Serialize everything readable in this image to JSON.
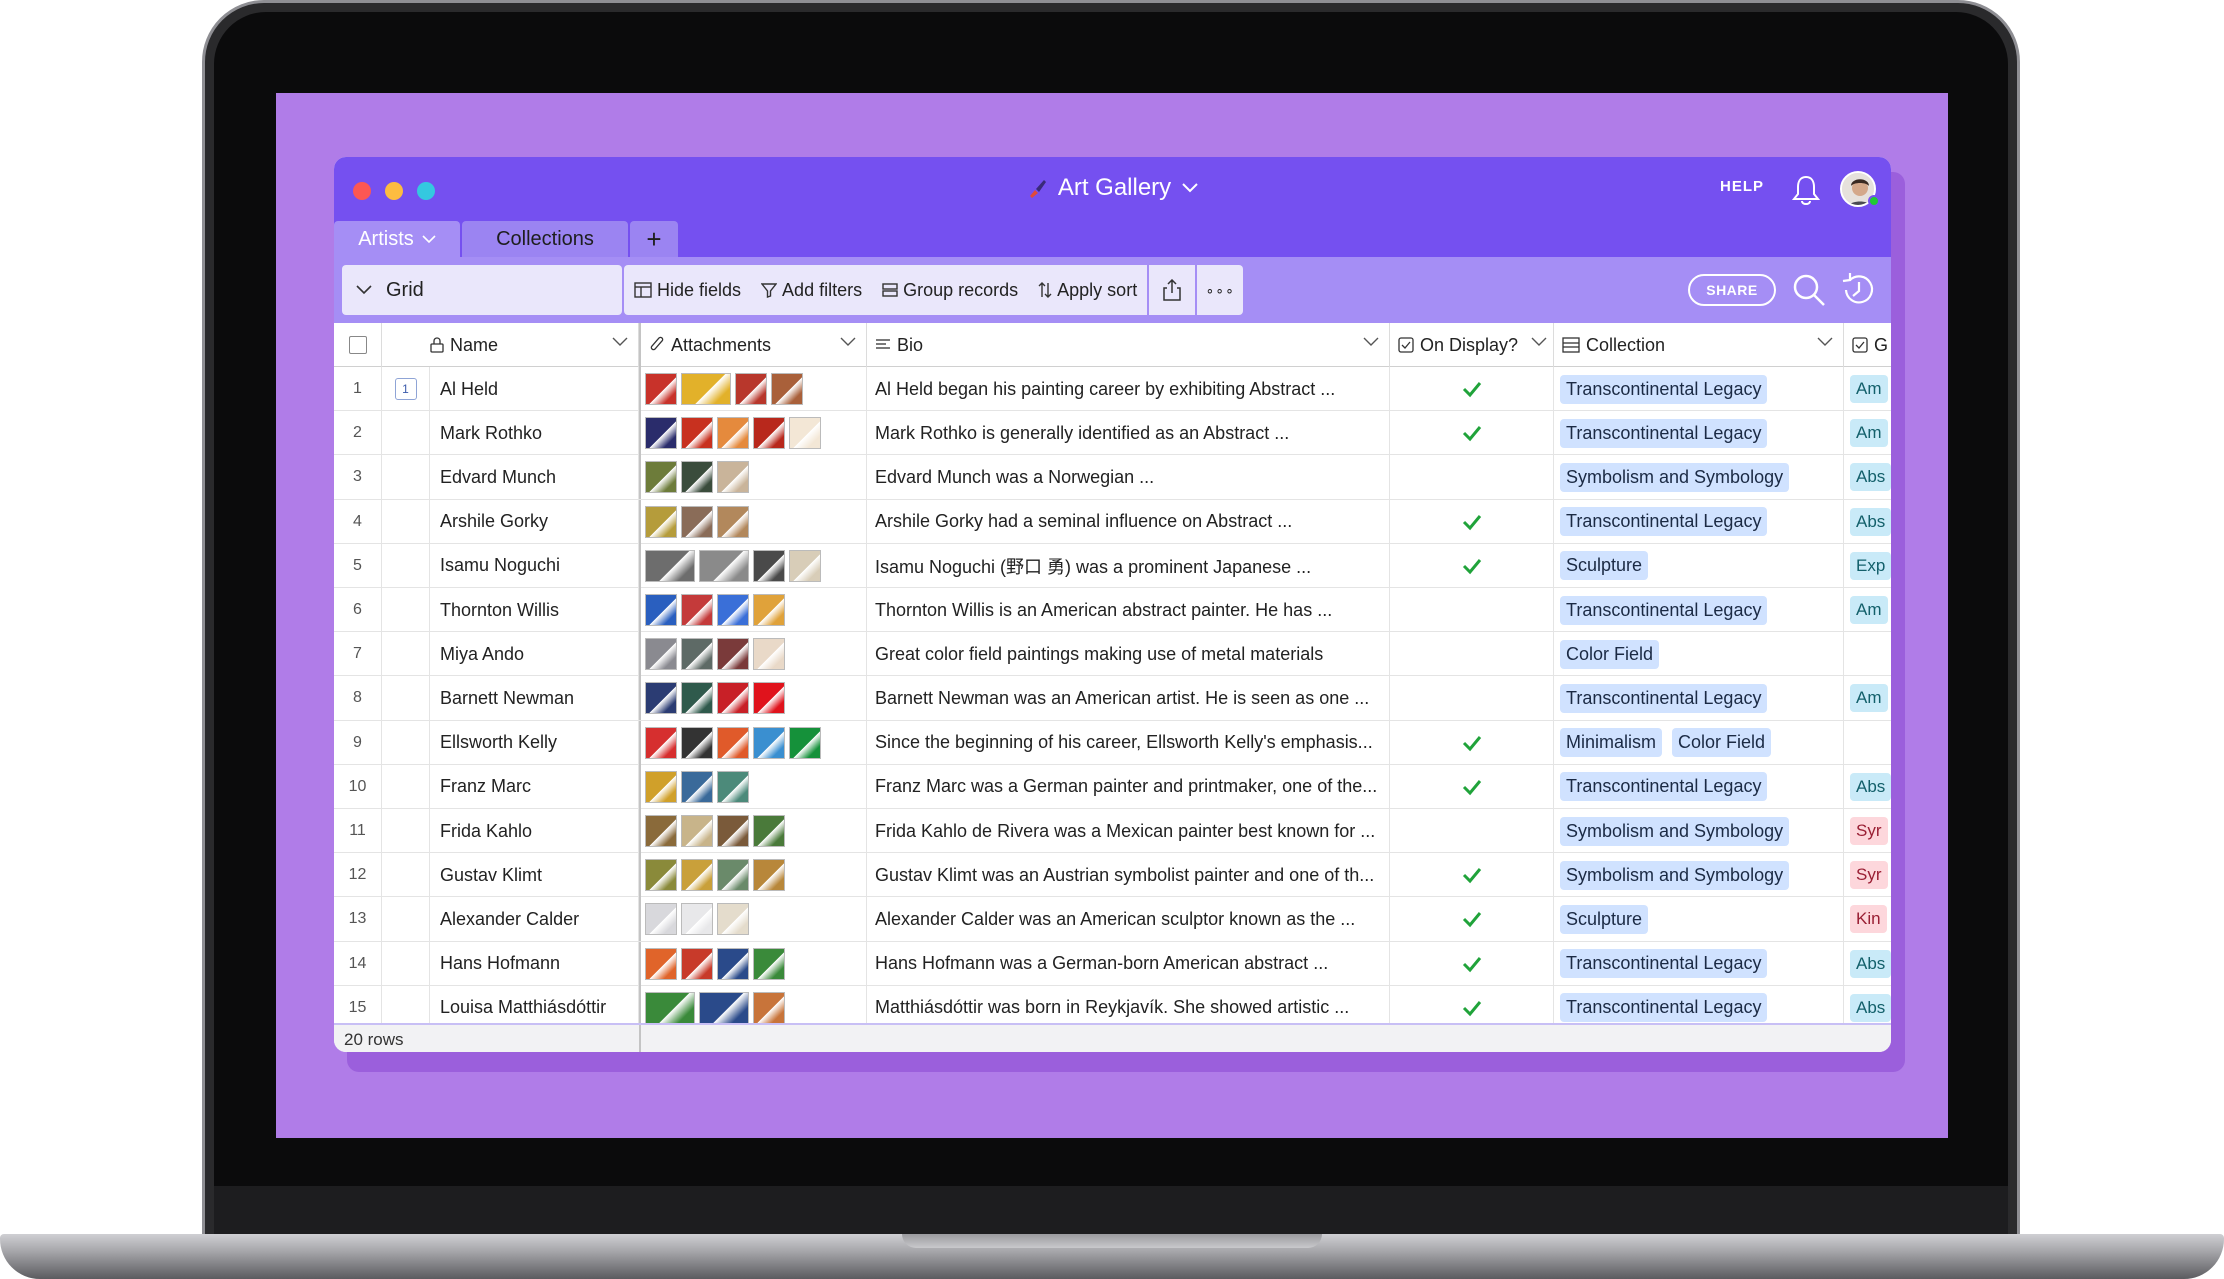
{
  "app": {
    "base_title": "Art Gallery",
    "help_label": "HELP",
    "share_label": "SHARE"
  },
  "tabs": [
    {
      "label": "Artists",
      "active": true
    },
    {
      "label": "Collections",
      "active": false
    },
    {
      "label": "+",
      "active": false
    }
  ],
  "toolbar": {
    "view_name": "Grid",
    "hide_fields": "Hide fields",
    "add_filters": "Add filters",
    "group_records": "Group records",
    "apply_sort": "Apply sort",
    "more": "∘∘∘"
  },
  "columns": {
    "name": "Name",
    "attachments": "Attachments",
    "bio": "Bio",
    "on_display": "On Display?",
    "collection": "Collection",
    "g": "G"
  },
  "rows": [
    {
      "num": "1",
      "name": "Al Held",
      "thumbs": [
        "#c8322a",
        "#e2b12a",
        "#b8372c",
        "#a9603a"
      ],
      "bio": "Al Held began his painting career by exhibiting Abstract ...",
      "on_display": true,
      "collections": [
        "Transcontinental Legacy"
      ],
      "g": "Am"
    },
    {
      "num": "2",
      "name": "Mark Rothko",
      "thumbs": [
        "#2a2c6b",
        "#c8311f",
        "#e58a3d",
        "#b8281c",
        "#f3e7d6"
      ],
      "bio": "Mark Rothko is generally identified as an Abstract ...",
      "on_display": true,
      "collections": [
        "Transcontinental Legacy"
      ],
      "g": "Am"
    },
    {
      "num": "3",
      "name": "Edvard Munch",
      "thumbs": [
        "#6d7c3a",
        "#3a4c3c",
        "#c9b49a"
      ],
      "bio": "Edvard Munch was a Norwegian ...",
      "on_display": false,
      "collections": [
        "Symbolism and Symbology"
      ],
      "g": "Abs"
    },
    {
      "num": "4",
      "name": "Arshile Gorky",
      "thumbs": [
        "#b59c3b",
        "#8a6c58",
        "#b2885c"
      ],
      "bio": "Arshile Gorky had a seminal influence on Abstract ...",
      "on_display": true,
      "collections": [
        "Transcontinental Legacy"
      ],
      "g": "Abs"
    },
    {
      "num": "5",
      "name": "Isamu Noguchi",
      "thumbs": [
        "#6d6d6d",
        "#8a8a8a",
        "#4a4a4a",
        "#d8cdb8"
      ],
      "bio": "Isamu Noguchi (野口 勇) was a prominent Japanese ...",
      "on_display": true,
      "collections": [
        "Sculpture"
      ],
      "g": "Exp"
    },
    {
      "num": "6",
      "name": "Thornton Willis",
      "thumbs": [
        "#2a5fbf",
        "#c43a3a",
        "#3a6fd8",
        "#e0a23a"
      ],
      "bio": "Thornton Willis is an American abstract painter. He has ...",
      "on_display": false,
      "collections": [
        "Transcontinental Legacy"
      ],
      "g": "Am"
    },
    {
      "num": "7",
      "name": "Miya Ando",
      "thumbs": [
        "#8a8a90",
        "#5e6a66",
        "#7a3a3a",
        "#e9d9c8"
      ],
      "bio": "Great color field paintings making use of metal materials",
      "on_display": false,
      "collections": [
        "Color Field"
      ],
      "g": ""
    },
    {
      "num": "8",
      "name": "Barnett Newman",
      "thumbs": [
        "#2b3c73",
        "#2f5a4c",
        "#c82027",
        "#e0131c"
      ],
      "bio": "Barnett Newman was an American artist. He is seen as one ...",
      "on_display": false,
      "collections": [
        "Transcontinental Legacy"
      ],
      "g": "Am"
    },
    {
      "num": "9",
      "name": "Ellsworth Kelly",
      "thumbs": [
        "#d62f2f",
        "#333333",
        "#e05a2a",
        "#3a8fd0",
        "#15913a"
      ],
      "bio": "Since the beginning of his career, Ellsworth Kelly's emphasis...",
      "on_display": true,
      "collections": [
        "Minimalism",
        "Color Field"
      ],
      "g": ""
    },
    {
      "num": "10",
      "name": "Franz Marc",
      "thumbs": [
        "#d0a02a",
        "#3a6a9a",
        "#4c8a7a"
      ],
      "bio": "Franz Marc was a German painter and printmaker, one of the...",
      "on_display": true,
      "collections": [
        "Transcontinental Legacy"
      ],
      "g": "Abs"
    },
    {
      "num": "11",
      "name": "Frida Kahlo",
      "thumbs": [
        "#8a6a3a",
        "#c8b48a",
        "#7a5a3a",
        "#4a7a3a"
      ],
      "bio": "Frida Kahlo de Rivera was a Mexican painter best known for ...",
      "on_display": false,
      "collections": [
        "Symbolism and Symbology"
      ],
      "g": "Syr"
    },
    {
      "num": "12",
      "name": "Gustav Klimt",
      "thumbs": [
        "#8a8a3a",
        "#c9a03a",
        "#6a8a6a",
        "#b8873a"
      ],
      "bio": "Gustav Klimt was an Austrian symbolist painter and one of th...",
      "on_display": true,
      "collections": [
        "Symbolism and Symbology"
      ],
      "g": "Syr"
    },
    {
      "num": "13",
      "name": "Alexander Calder",
      "thumbs": [
        "#d8d8dc",
        "#e8e8ea",
        "#e4dccc"
      ],
      "bio": "Alexander Calder was an American sculptor known as the ...",
      "on_display": true,
      "collections": [
        "Sculpture"
      ],
      "g": "Kin"
    },
    {
      "num": "14",
      "name": "Hans Hofmann",
      "thumbs": [
        "#e0642a",
        "#c83a2a",
        "#2a4a8a",
        "#3a8a3a"
      ],
      "bio": "Hans Hofmann was a German-born American abstract ...",
      "on_display": true,
      "collections": [
        "Transcontinental Legacy"
      ],
      "g": "Abs"
    },
    {
      "num": "15",
      "name": "Louisa Matthiásdóttir",
      "thumbs": [
        "#3a8a3a",
        "#2a4a8a",
        "#c8743a"
      ],
      "bio": "Matthiásdóttir was born in Reykjavík. She showed artistic ...",
      "on_display": true,
      "collections": [
        "Transcontinental Legacy"
      ],
      "g": "Abs"
    }
  ],
  "first_row_comment_count": "1",
  "footer": {
    "row_count": "20 rows"
  },
  "colors": {
    "accent": "#7550f0",
    "toolbar": "#a58ef5",
    "screen": "#b07ce8",
    "check": "#20a33a"
  },
  "icons": [
    "brush-icon",
    "chevron-down-icon",
    "bell-icon",
    "avatar",
    "grid-view-icon",
    "hide-fields-icon",
    "filter-icon",
    "group-icon",
    "sort-icon",
    "share-export-icon",
    "more-icon",
    "search-icon",
    "history-icon",
    "lock-icon",
    "paperclip-icon",
    "long-text-icon",
    "checkbox-icon",
    "link-icon",
    "check-icon"
  ]
}
